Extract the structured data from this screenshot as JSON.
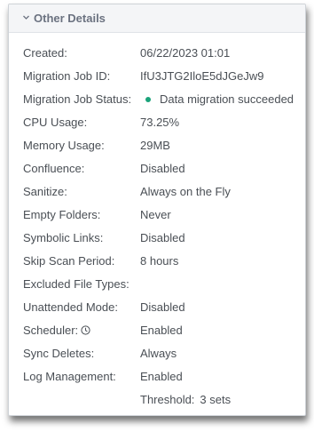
{
  "header": {
    "title": "Other Details",
    "icon": "chevron-down-icon"
  },
  "colors": {
    "status_success": "#1aa37a",
    "text": "#4a4f55",
    "header_text": "#6b7280"
  },
  "details": {
    "created": {
      "label": "Created:",
      "value": "06/22/2023 01:01"
    },
    "migration_job_id": {
      "label": "Migration Job ID:",
      "value": "IfU3JTG2IloE5dJGeJw9"
    },
    "migration_job_status": {
      "label": "Migration Job Status:",
      "value": "Data migration succeeded"
    },
    "cpu_usage": {
      "label": "CPU Usage:",
      "value": "73.25%"
    },
    "memory_usage": {
      "label": "Memory Usage:",
      "value": "29MB"
    },
    "confluence": {
      "label": "Confluence:",
      "value": "Disabled"
    },
    "sanitize": {
      "label": "Sanitize:",
      "value": "Always on the Fly"
    },
    "empty_folders": {
      "label": "Empty Folders:",
      "value": "Never"
    },
    "symbolic_links": {
      "label": "Symbolic Links:",
      "value": "Disabled"
    },
    "skip_scan_period": {
      "label": "Skip Scan Period:",
      "value": "8 hours"
    },
    "excluded_file_types": {
      "label": "Excluded File Types:",
      "value": ""
    },
    "unattended_mode": {
      "label": "Unattended Mode:",
      "value": "Disabled"
    },
    "scheduler": {
      "label": "Scheduler:",
      "value": "Enabled",
      "icon": "clock-icon"
    },
    "sync_deletes": {
      "label": "Sync Deletes:",
      "value": "Always"
    },
    "log_management": {
      "label": "Log Management:",
      "value": "Enabled"
    },
    "threshold": {
      "label": "Threshold:",
      "value": "3 sets"
    }
  }
}
